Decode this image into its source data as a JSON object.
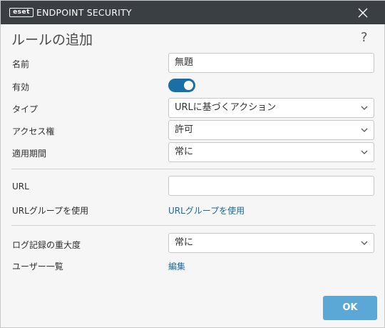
{
  "app": {
    "logo_text": "eset",
    "brand": "ENDPOINT SECURITY"
  },
  "dialog": {
    "title": "ルールの追加",
    "help": "?"
  },
  "form": {
    "name_label": "名前",
    "name_value": "無題",
    "enabled_label": "有効",
    "enabled": true,
    "type_label": "タイプ",
    "type_value": "URLに基づくアクション",
    "access_label": "アクセス権",
    "access_value": "許可",
    "period_label": "適用期間",
    "period_value": "常に",
    "url_label": "URL",
    "url_value": "",
    "url_group_label": "URLグループを使用",
    "url_group_link": "URLグループを使用",
    "log_label": "ログ記録の重大度",
    "log_value": "常に",
    "users_label": "ユーザー一覧",
    "users_link": "編集"
  },
  "footer": {
    "ok_label": "OK"
  },
  "colors": {
    "titlebar": "#3a3f44",
    "accent": "#1a6fa7",
    "ok_button": "#5ba8d6",
    "link": "#1a6a96"
  }
}
